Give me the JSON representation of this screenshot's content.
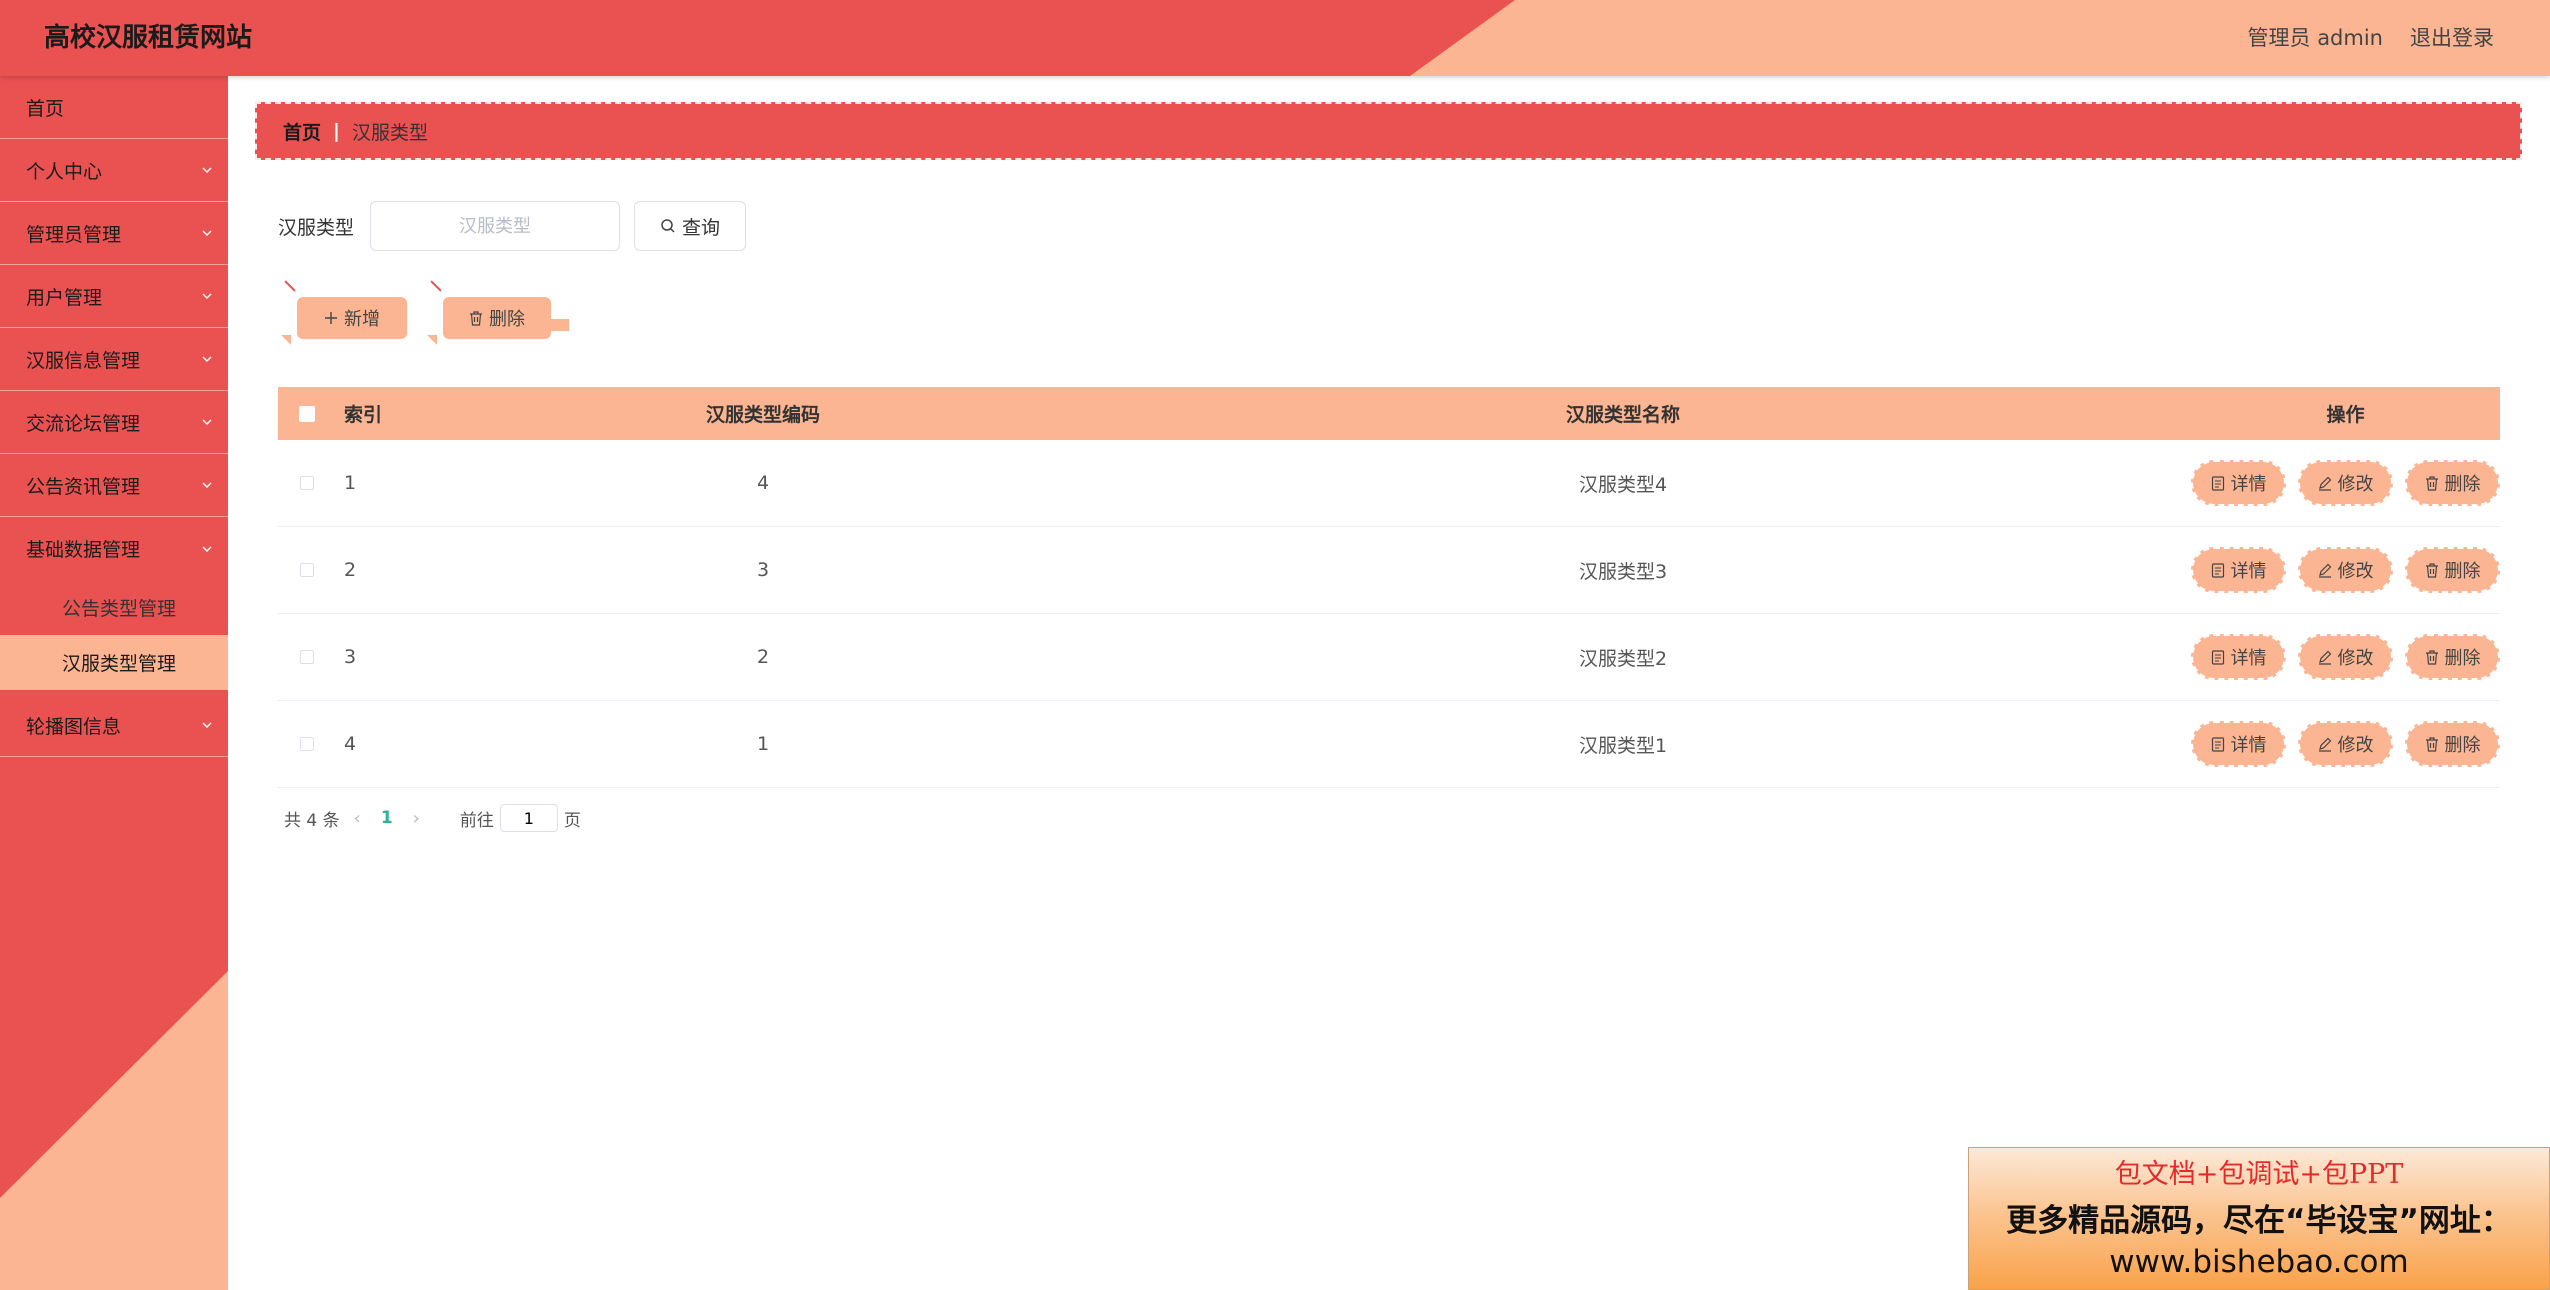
{
  "header": {
    "title": "高校汉服租赁网站",
    "user": "管理员 admin",
    "logout": "退出登录"
  },
  "sidebar": {
    "items": [
      {
        "label": "首页"
      },
      {
        "label": "个人中心"
      },
      {
        "label": "管理员管理"
      },
      {
        "label": "用户管理"
      },
      {
        "label": "汉服信息管理"
      },
      {
        "label": "交流论坛管理"
      },
      {
        "label": "公告资讯管理"
      },
      {
        "label": "基础数据管理"
      },
      {
        "label": "轮播图信息"
      }
    ],
    "submenu": [
      {
        "label": "公告类型管理"
      },
      {
        "label": "汉服类型管理"
      }
    ]
  },
  "breadcrumb": {
    "home": "首页",
    "current": "汉服类型"
  },
  "search": {
    "label": "汉服类型",
    "placeholder": "汉服类型",
    "button": "查询"
  },
  "actions": {
    "add": "新增",
    "delete": "删除"
  },
  "table": {
    "headers": {
      "index": "索引",
      "code": "汉服类型编码",
      "name": "汉服类型名称",
      "ops": "操作"
    },
    "rows": [
      {
        "index": "1",
        "code": "4",
        "name": "汉服类型4"
      },
      {
        "index": "2",
        "code": "3",
        "name": "汉服类型3"
      },
      {
        "index": "3",
        "code": "2",
        "name": "汉服类型2"
      },
      {
        "index": "4",
        "code": "1",
        "name": "汉服类型1"
      }
    ],
    "op_labels": {
      "detail": "详情",
      "edit": "修改",
      "delete": "删除"
    }
  },
  "pager": {
    "total": "共 4 条",
    "current_page": "1",
    "goto_prefix": "前往",
    "goto_value": "1",
    "goto_suffix": "页"
  },
  "watermark": {
    "line1": "包文档+包调试+包PPT",
    "line2": "更多精品源码，尽在“毕设宝”网址：",
    "line3": "www.bishebao.com"
  },
  "colors": {
    "primary_red": "#ea5252",
    "peach": "#fbb592",
    "page_active": "#2bb39b"
  }
}
